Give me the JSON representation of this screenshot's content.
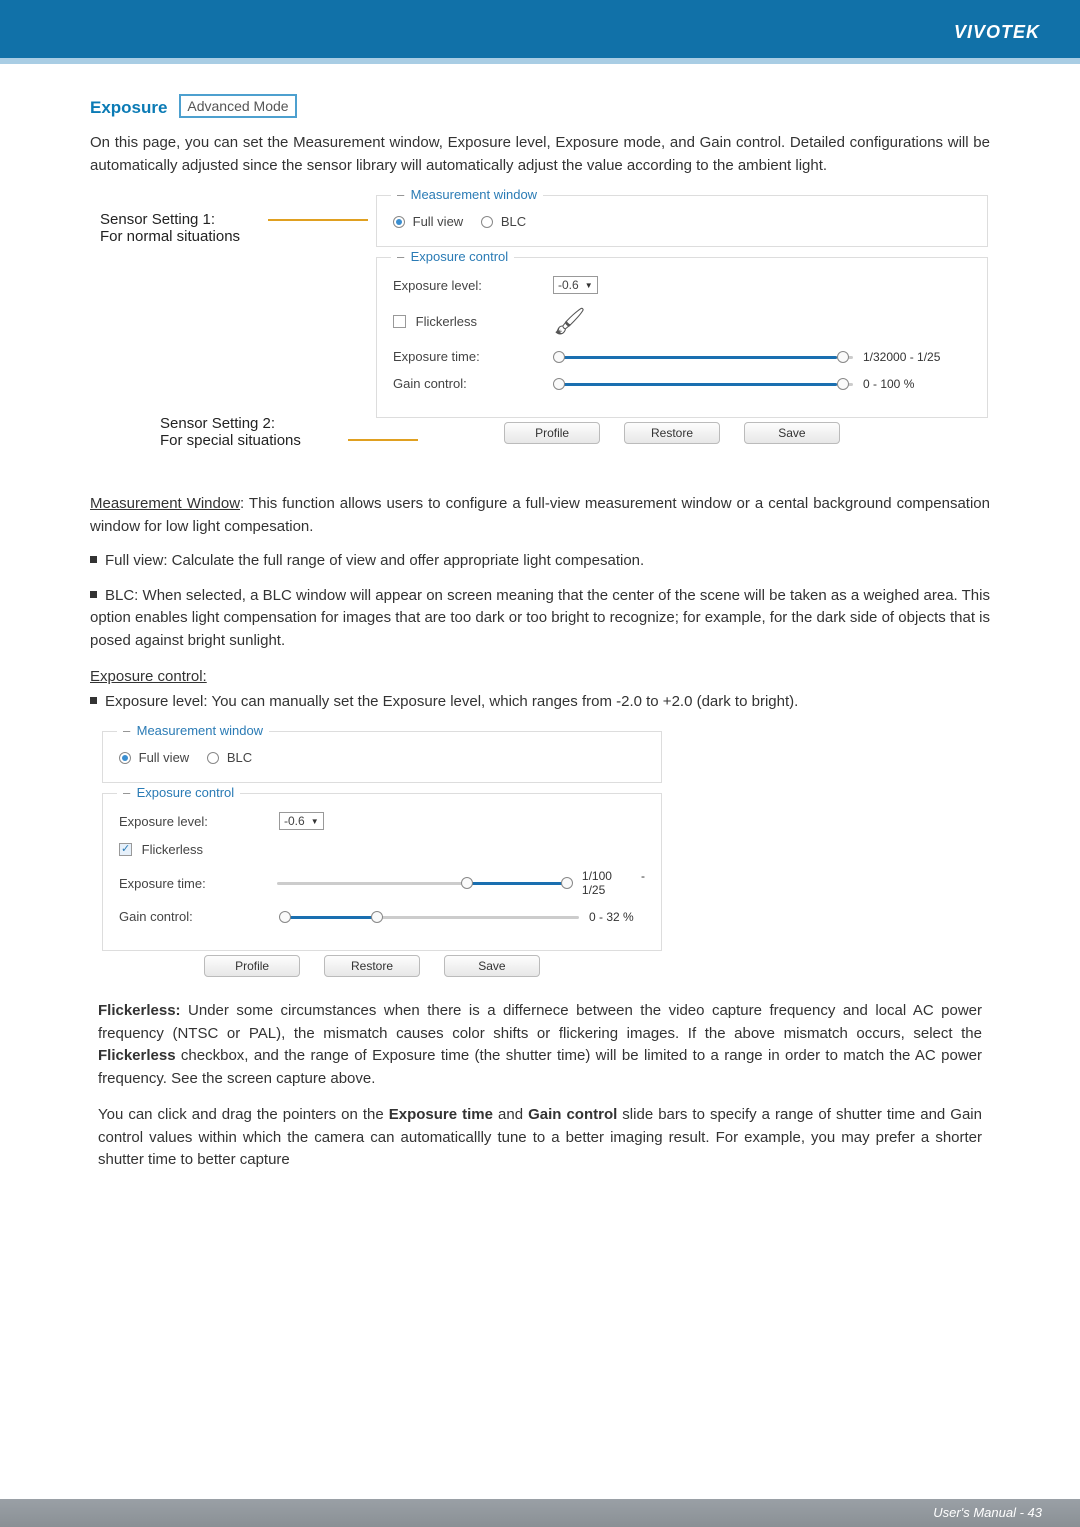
{
  "brand": "VIVOTEK",
  "section_title": "Exposure",
  "mode_badge": "Advanced Mode",
  "intro": "On this page, you can set the Measurement window, Exposure level, Exposure mode, and Gain control. Detailed configurations will be automatically adjusted since the sensor library will automatically adjust the value according to the ambient light.",
  "callout1": {
    "l1": "Sensor Setting 1:",
    "l2": "For normal situations"
  },
  "callout2": {
    "l1": "Sensor Setting 2:",
    "l2": "For special situations"
  },
  "panels": {
    "measurement": {
      "legend": "Measurement window",
      "full_view": "Full view",
      "blc": "BLC"
    },
    "exposure": {
      "legend": "Exposure control",
      "level_label": "Exposure level:",
      "level_value": "-0.6",
      "flickerless": "Flickerless",
      "time_label": "Exposure time:",
      "time_value": "1/32000 - 1/25",
      "gain_label": "Gain control:",
      "gain_value": "0 - 100 %"
    },
    "buttons": {
      "profile": "Profile",
      "restore": "Restore",
      "save": "Save"
    }
  },
  "mw_heading": "Measurement Window",
  "mw_text": ": This function allows users to configure a full-view measurement window or a cental background compensation window for low light compesation.",
  "fv_text": "Full view: Calculate the full range of view and offer appropriate light compesation.",
  "blc_text": "BLC: When selected, a BLC window will appear on screen meaning that the center of the scene will be taken as a weighed area. This option enables light compensation for images that are too dark or too bright to recognize; for example, for the dark side of objects that is posed against bright sunlight.",
  "ec_heading": "Exposure control:",
  "el_text": "Exposure level: You can manually set the Exposure level, which ranges from -2.0 to +2.0 (dark to bright).",
  "panels2": {
    "exposure": {
      "level_value": "-0.6",
      "time_value": "1/100 - 1/25",
      "gain_value": "0 - 32 %"
    }
  },
  "flickerless_para_parts": {
    "lead": "Flickerless:",
    "mid1": " Under some circumstances when there is a differnece between the video capture frequency and local AC power frequency (NTSC or PAL), the mismatch causes color shifts or flickering images. If the above mismatch occurs, select the ",
    "bold": "Flickerless",
    "mid2": " checkbox, and the range of Exposure time (the shutter time) will be limited to a range in order to match the AC power frequency. See the screen capture above."
  },
  "drag_para_parts": {
    "lead": "You can click and drag the pointers on the ",
    "b1": "Exposure time",
    "mid": " and ",
    "b2": "Gain control",
    "tail": " slide bars to specify a range of shutter time and Gain control values within which the camera can automaticallly tune to a better imaging result. For example, you may prefer a shorter shutter time to better capture"
  },
  "footer": "User's Manual - 43"
}
